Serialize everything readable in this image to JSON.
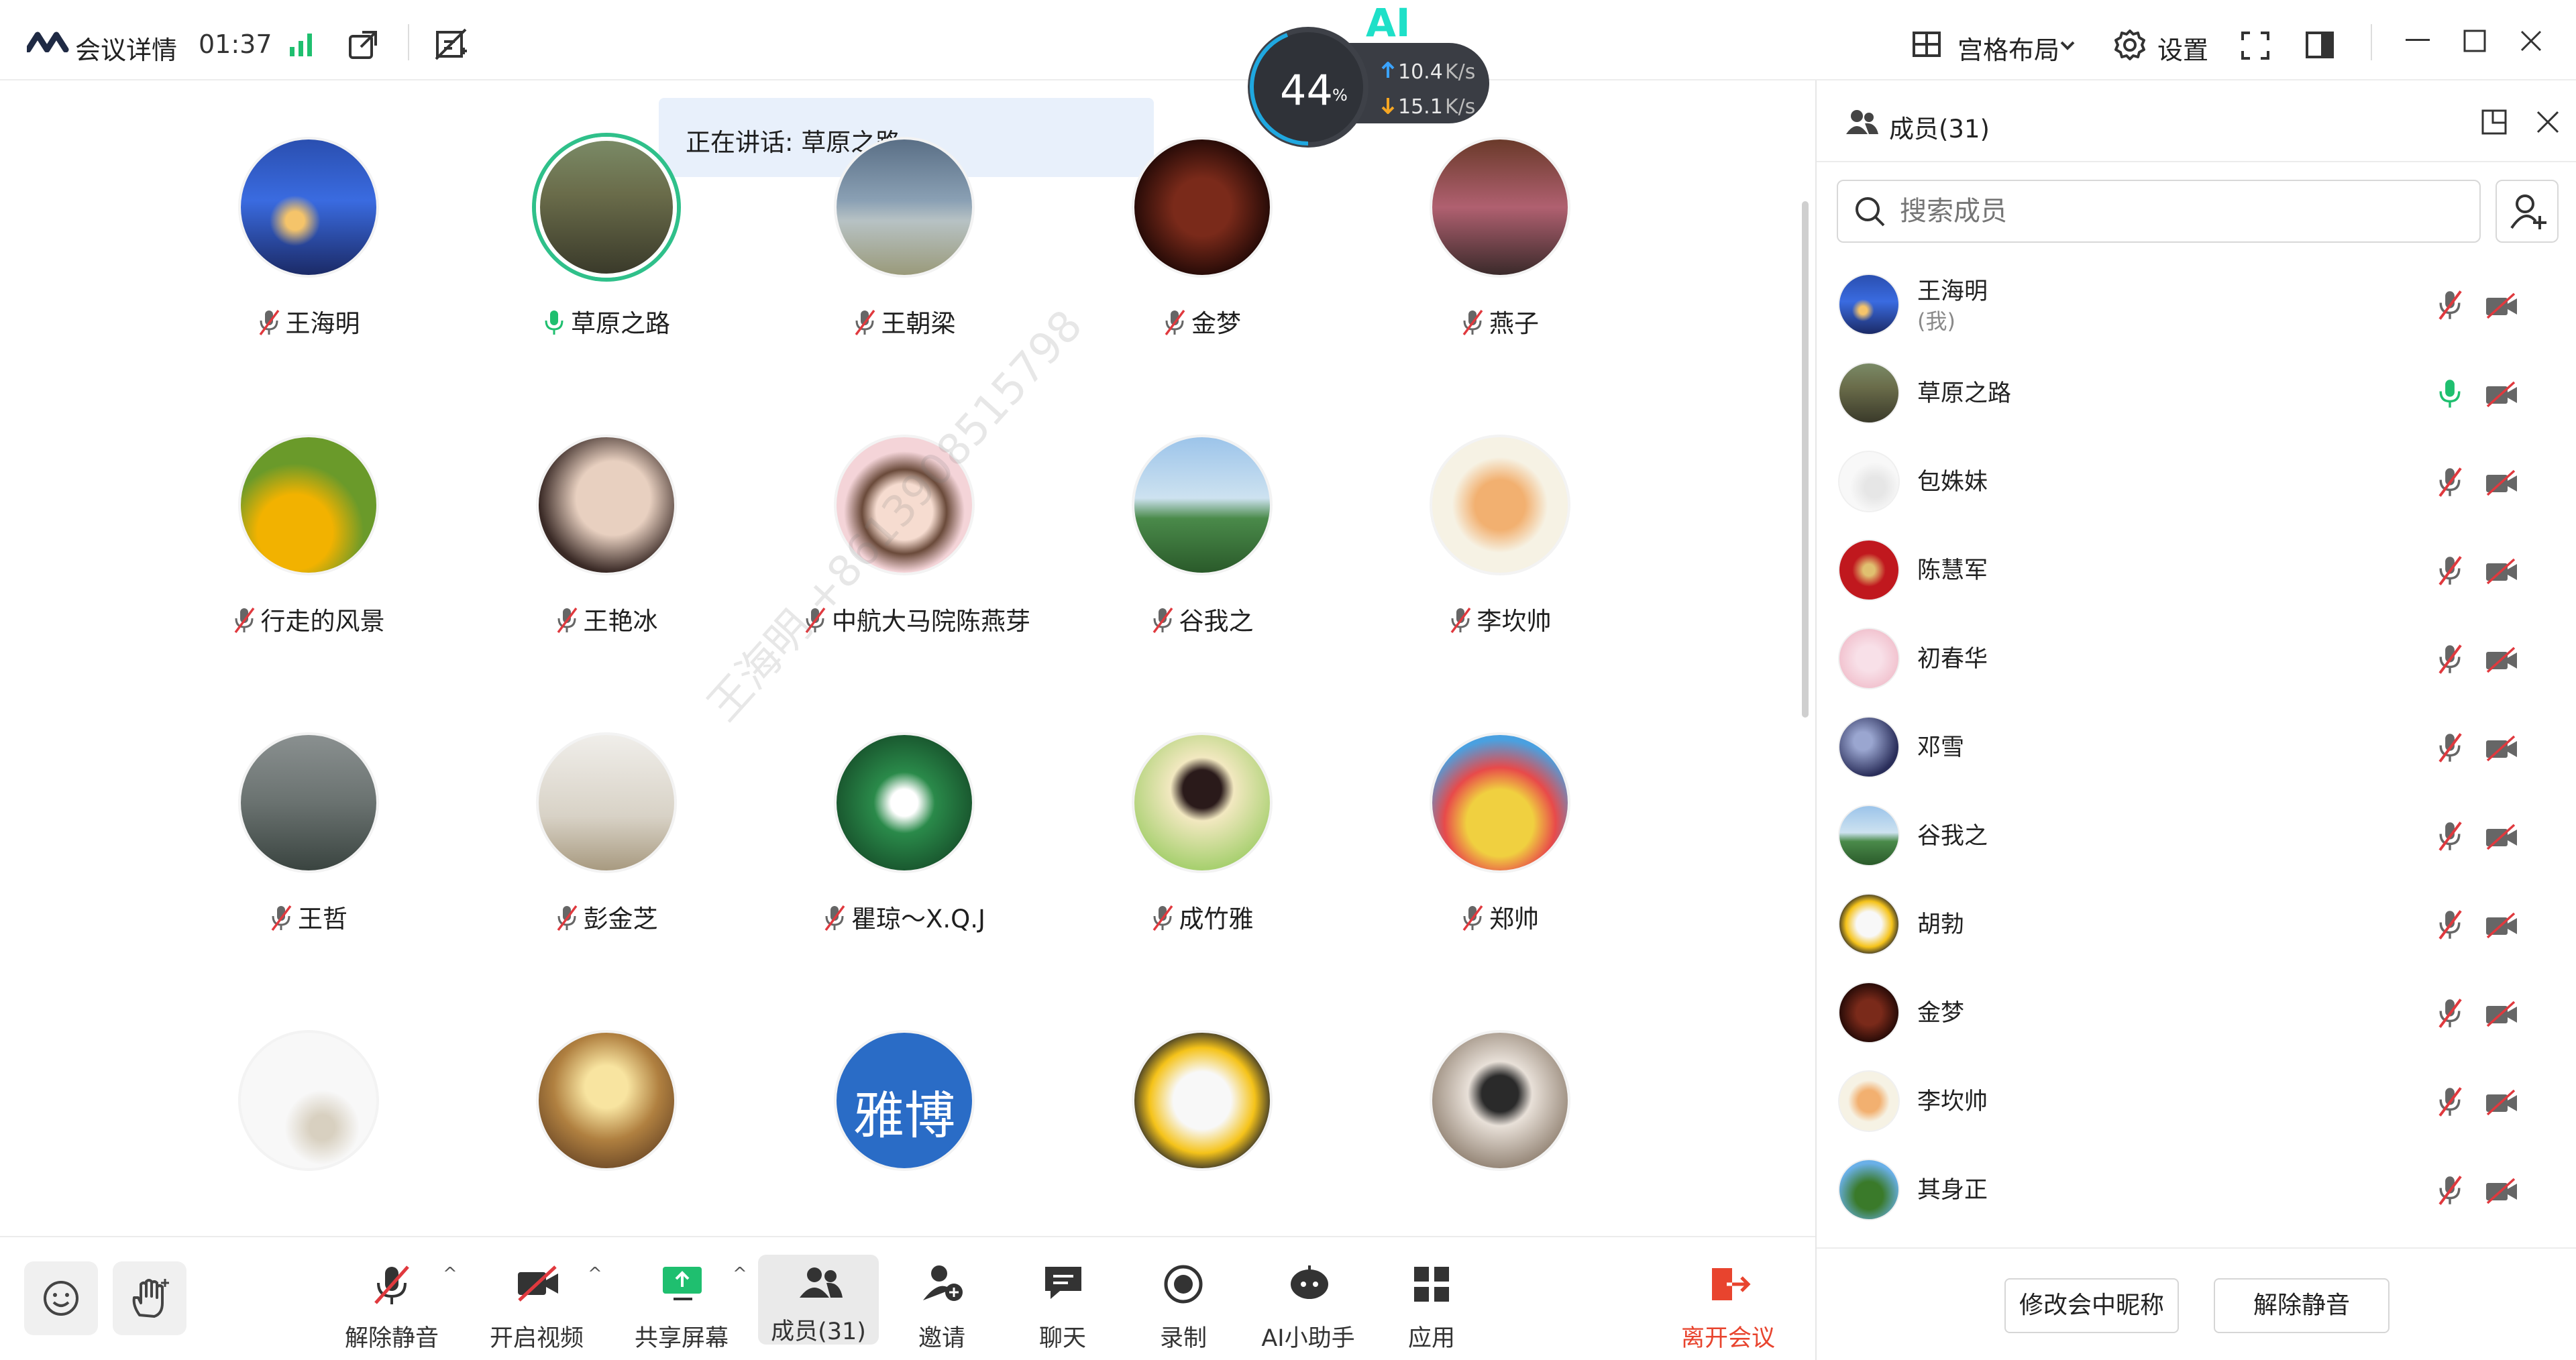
{
  "topbar": {
    "meeting_info": "会议详情",
    "timer": "01:37",
    "layout_label": "宫格布局",
    "settings_label": "设置"
  },
  "network": {
    "ai_badge": "AI",
    "cpu_percent": "44",
    "percent_sign": "%",
    "upload": "10.4",
    "download": "15.1",
    "unit": "K/s"
  },
  "speaking_banner": "正在讲话: 草原之路;",
  "watermark": "王海明 +8613908515798",
  "grid": [
    {
      "name": "王海明",
      "mic": "off"
    },
    {
      "name": "草原之路",
      "mic": "on"
    },
    {
      "name": "王朝梁",
      "mic": "off"
    },
    {
      "name": "金梦",
      "mic": "off"
    },
    {
      "name": "燕子",
      "mic": "off"
    },
    {
      "name": "行走的风景",
      "mic": "off"
    },
    {
      "name": "王艳冰",
      "mic": "off"
    },
    {
      "name": "中航大马院陈燕芽",
      "mic": "off"
    },
    {
      "name": "谷我之",
      "mic": "off"
    },
    {
      "name": "李坎帅",
      "mic": "off"
    },
    {
      "name": "王哲",
      "mic": "off"
    },
    {
      "name": "彭金芝",
      "mic": "off"
    },
    {
      "name": "瞿琼～X.Q.J",
      "mic": "off"
    },
    {
      "name": "成竹雅",
      "mic": "off"
    },
    {
      "name": "郑帅",
      "mic": "off"
    },
    {
      "name": "",
      "mic": "off"
    },
    {
      "name": "",
      "mic": "off"
    },
    {
      "name": "",
      "mic": "off",
      "avatar_text": "雅博"
    },
    {
      "name": "",
      "mic": "off"
    },
    {
      "name": "",
      "mic": "off"
    }
  ],
  "panel": {
    "title": "成员(31)",
    "search_placeholder": "搜索成员",
    "members": [
      {
        "name": "王海明",
        "sub": "(我)",
        "mic": "off"
      },
      {
        "name": "草原之路",
        "sub": "",
        "mic": "on"
      },
      {
        "name": "包姝妹",
        "sub": "",
        "mic": "off"
      },
      {
        "name": "陈慧军",
        "sub": "",
        "mic": "off"
      },
      {
        "name": "初春华",
        "sub": "",
        "mic": "off"
      },
      {
        "name": "邓雪",
        "sub": "",
        "mic": "off"
      },
      {
        "name": "谷我之",
        "sub": "",
        "mic": "off"
      },
      {
        "name": "胡勃",
        "sub": "",
        "mic": "off"
      },
      {
        "name": "金梦",
        "sub": "",
        "mic": "off"
      },
      {
        "name": "李坎帅",
        "sub": "",
        "mic": "off"
      },
      {
        "name": "其身正",
        "sub": "",
        "mic": "off"
      }
    ],
    "rename_button": "修改会中昵称",
    "unmute_button": "解除静音"
  },
  "bottombar": {
    "unmute": "解除静音",
    "start_video": "开启视频",
    "share_screen": "共享屏幕",
    "members": "成员(31)",
    "invite": "邀请",
    "chat": "聊天",
    "record": "录制",
    "ai_assistant": "AI小助手",
    "apps": "应用",
    "leave": "离开会议"
  },
  "colors": {
    "accent_green": "#1fbf6f",
    "mute_red": "#e0393e",
    "leave_red": "#e8442e",
    "ai_cyan": "#1ee0c8"
  }
}
